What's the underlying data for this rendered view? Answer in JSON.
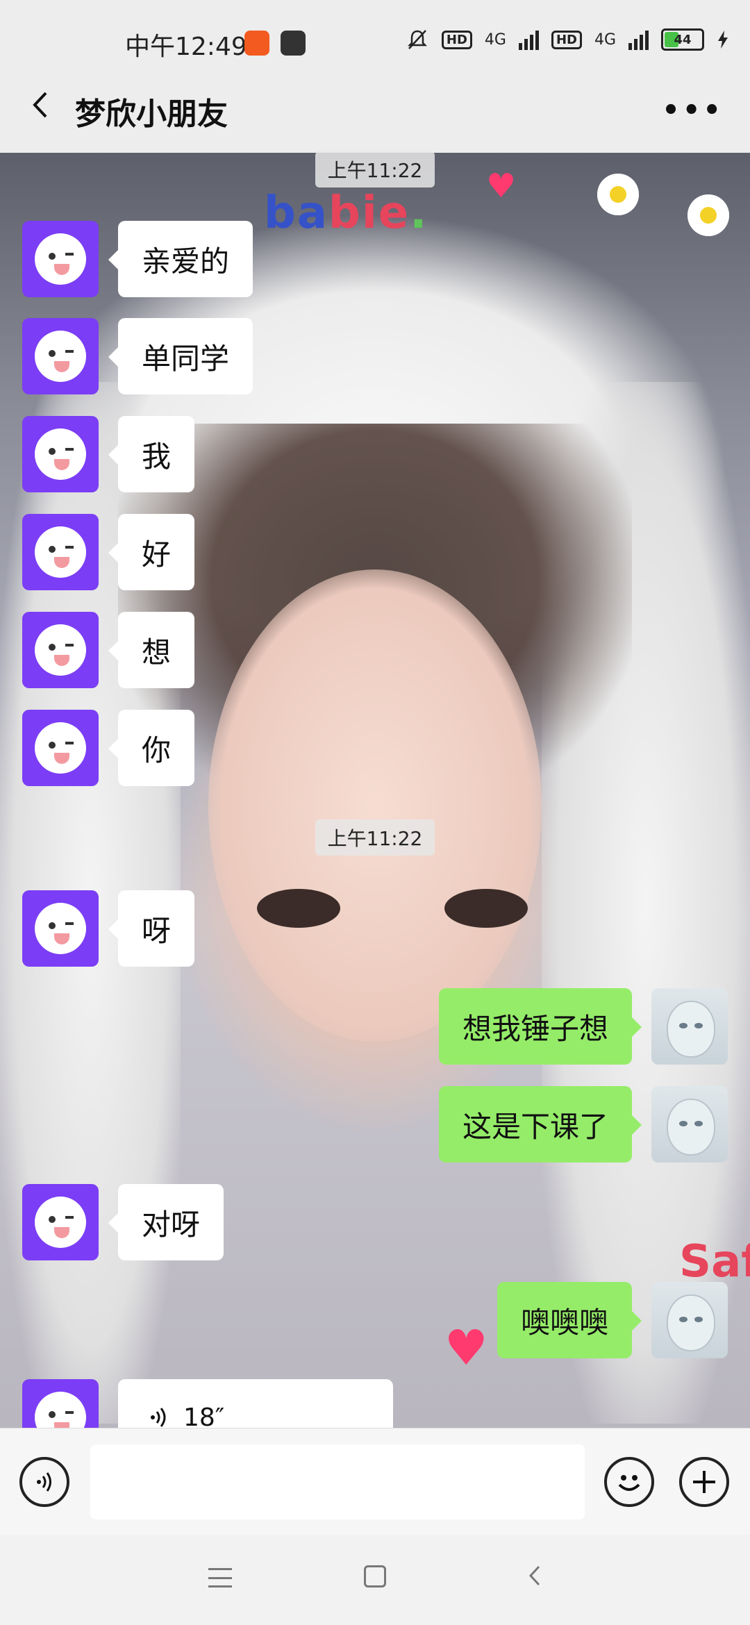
{
  "status_bar": {
    "time": "中午12:49",
    "hd_1": "HD",
    "net_1": "4G",
    "hd_2": "HD",
    "net_2": "4G",
    "battery": "44"
  },
  "header": {
    "back_icon": "chevron-left-icon",
    "title": "梦欣小朋友",
    "more_icon": "more-dots-icon"
  },
  "background": {
    "sticker_text": "babie.",
    "sticker_text_2": "Saf"
  },
  "messages": [
    {
      "type": "time",
      "text": "上午11:22"
    },
    {
      "type": "left",
      "text": "亲爱的"
    },
    {
      "type": "left",
      "text": "单同学"
    },
    {
      "type": "left",
      "text": "我"
    },
    {
      "type": "left",
      "text": "好"
    },
    {
      "type": "left",
      "text": "想"
    },
    {
      "type": "left",
      "text": "你"
    },
    {
      "type": "time",
      "text": "上午11:22"
    },
    {
      "type": "left",
      "text": "呀"
    },
    {
      "type": "right",
      "text": "想我锤子想"
    },
    {
      "type": "right",
      "text": "这是下课了"
    },
    {
      "type": "left",
      "text": "对呀"
    },
    {
      "type": "right",
      "text": "噢噢噢"
    },
    {
      "type": "voice",
      "text": "18″"
    }
  ],
  "input": {
    "voice_icon": "voice-icon",
    "emoji_icon": "emoji-icon",
    "plus_icon": "plus-icon",
    "placeholder": ""
  },
  "nav": {
    "menu_icon": "menu-icon",
    "home_icon": "home-icon",
    "back_icon": "back-icon"
  }
}
